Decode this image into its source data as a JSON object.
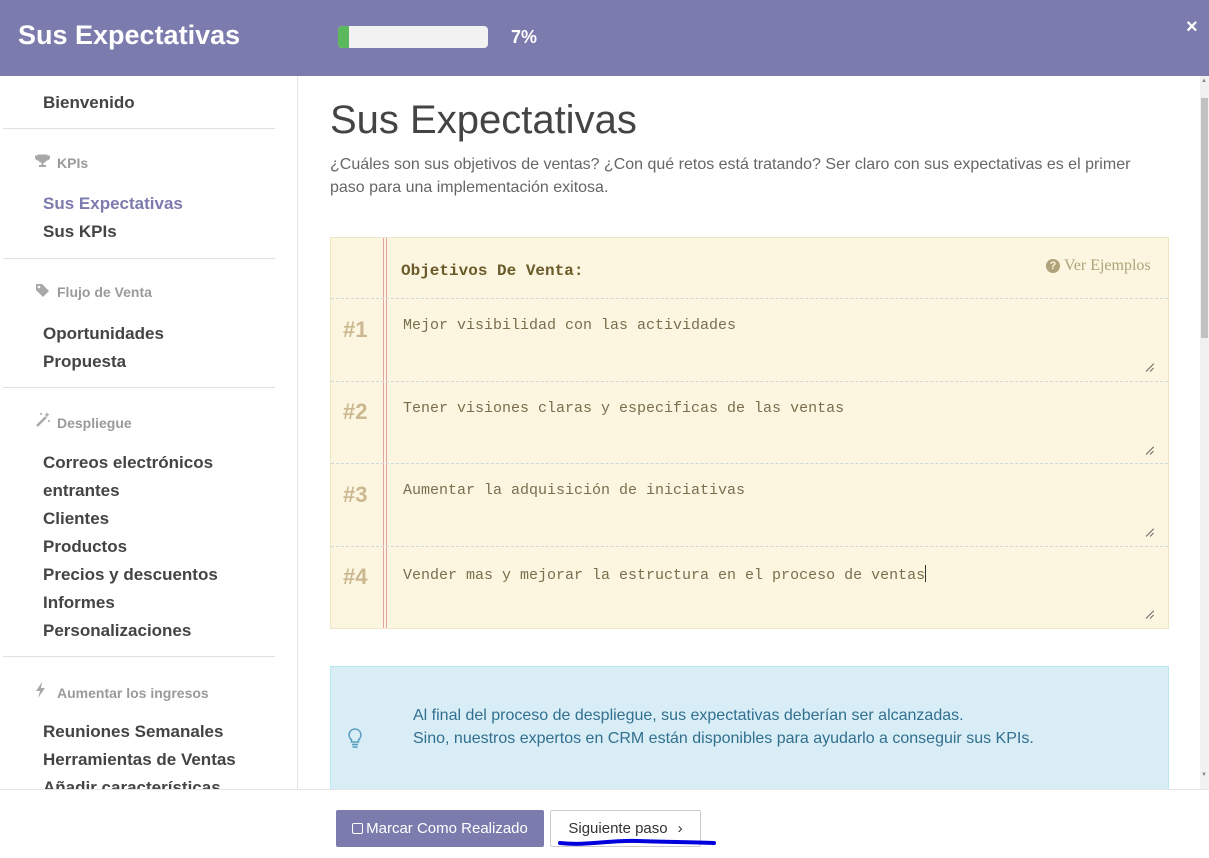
{
  "header": {
    "title": "Sus Expectativas",
    "progress_value": 7,
    "progress_label": "7%",
    "close_label": "×"
  },
  "sidebar": {
    "welcome": "Bienvenido",
    "sections": [
      {
        "category": "KPIs",
        "icon": "trophy-icon",
        "items": [
          "Sus Expectativas",
          "Sus KPIs"
        ]
      },
      {
        "category": "Flujo de Venta",
        "icon": "tag-icon",
        "items": [
          "Oportunidades",
          "Propuesta"
        ]
      },
      {
        "category": "Despliegue",
        "icon": "magic-wand-icon",
        "items": [
          "Correos electrónicos",
          "entrantes",
          "Clientes",
          "Productos",
          "Precios y descuentos",
          "Informes",
          "Personalizaciones"
        ]
      },
      {
        "category": "Aumentar los ingresos",
        "icon": "bolt-icon",
        "items": [
          "Reuniones Semanales",
          "Herramientas de Ventas",
          "Añadir características"
        ]
      }
    ],
    "active_item": "Sus Expectativas"
  },
  "main": {
    "title": "Sus Expectativas",
    "intro": "¿Cuáles son sus objetivos de ventas? ¿Con qué retos está tratando? Ser claro con sus expectativas es el primer paso para una implementación exitosa.",
    "notebook": {
      "title": "Objetivos De Venta:",
      "examples_label": "Ver Ejemplos",
      "rows": [
        {
          "num": "#1",
          "text": "Mejor visibilidad con las actividades"
        },
        {
          "num": "#2",
          "text": "Tener visiones claras y especificas de las ventas"
        },
        {
          "num": "#3",
          "text": "Aumentar la adquisición de iniciativas"
        },
        {
          "num": "#4",
          "text": "Vender mas y mejorar la estructura en el proceso de ventas"
        }
      ]
    },
    "info": {
      "line1": "Al final del proceso de despliegue, sus expectativas deberían ser alcanzadas.",
      "line2": "Sino, nuestros expertos en CRM están disponibles para ayudarlo a conseguir sus KPIs."
    }
  },
  "footer": {
    "done_label": "Marcar Como Realizado",
    "next_label": "Siguiente paso",
    "next_chevron": "›"
  },
  "colors": {
    "header": "#7c7bad",
    "progress": "#5cb85c",
    "notebook_bg": "#fcf6e0",
    "info_bg": "#d9edf7",
    "annotation": "#0000dd"
  }
}
